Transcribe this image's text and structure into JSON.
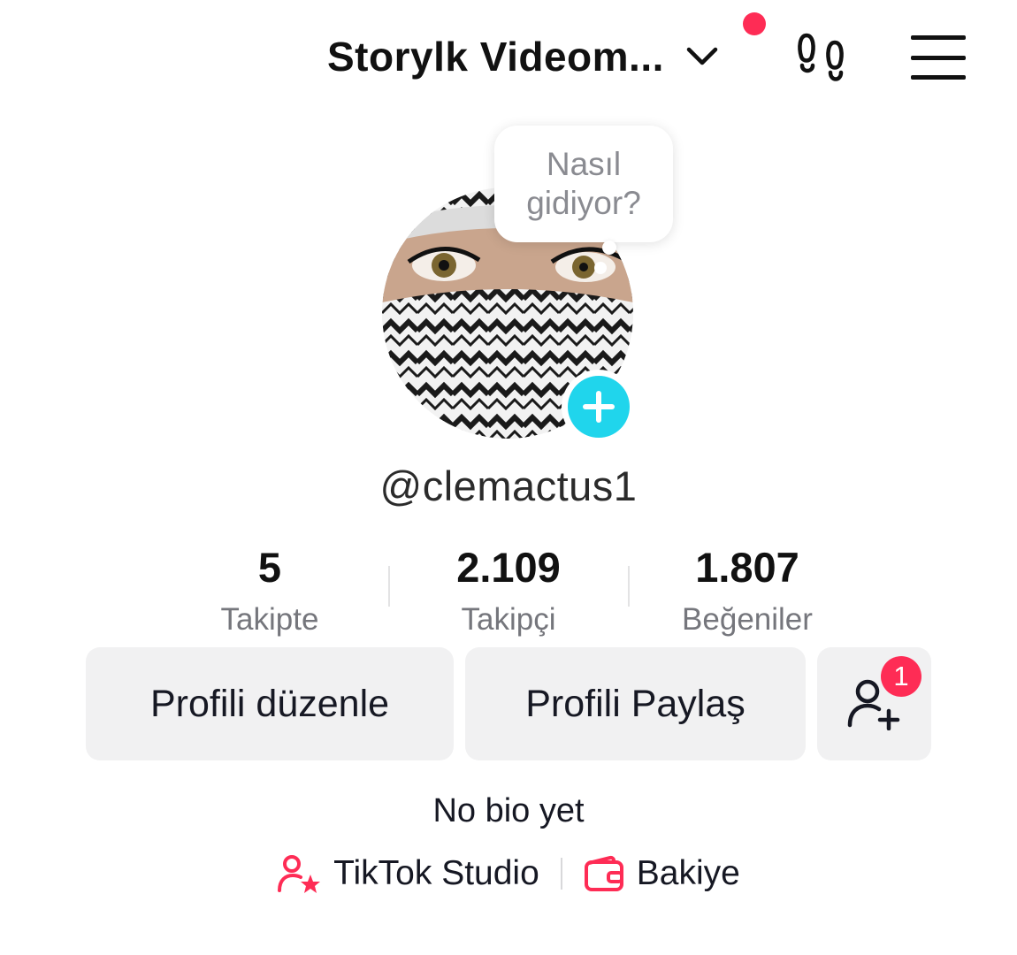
{
  "header": {
    "account_name": "Storylk Videom...",
    "icons": {
      "switch": "chevron-down-icon",
      "footprint": "footprints-icon",
      "menu": "hamburger-menu-icon"
    },
    "notification_dot_color": "#fe2c55"
  },
  "profile": {
    "bubble_text_line1": "Nasıl",
    "bubble_text_line2": "gidiyor?",
    "username": "@clemactus1",
    "add_icon": "plus-icon",
    "accent_color": "#20d5ec"
  },
  "stats": [
    {
      "value": "5",
      "label": "Takipte"
    },
    {
      "value": "2.109",
      "label": "Takipçi"
    },
    {
      "value": "1.807",
      "label": "Beğeniler"
    }
  ],
  "actions": {
    "edit_label": "Profili düzenle",
    "share_label": "Profili Paylaş",
    "friend_badge": "1",
    "friend_icon": "add-friend-icon"
  },
  "bio": "No bio yet",
  "links": {
    "studio_label": "TikTok Studio",
    "studio_icon": "creator-star-icon",
    "balance_label": "Bakiye",
    "balance_icon": "wallet-icon",
    "icon_color": "#fe2c55"
  }
}
